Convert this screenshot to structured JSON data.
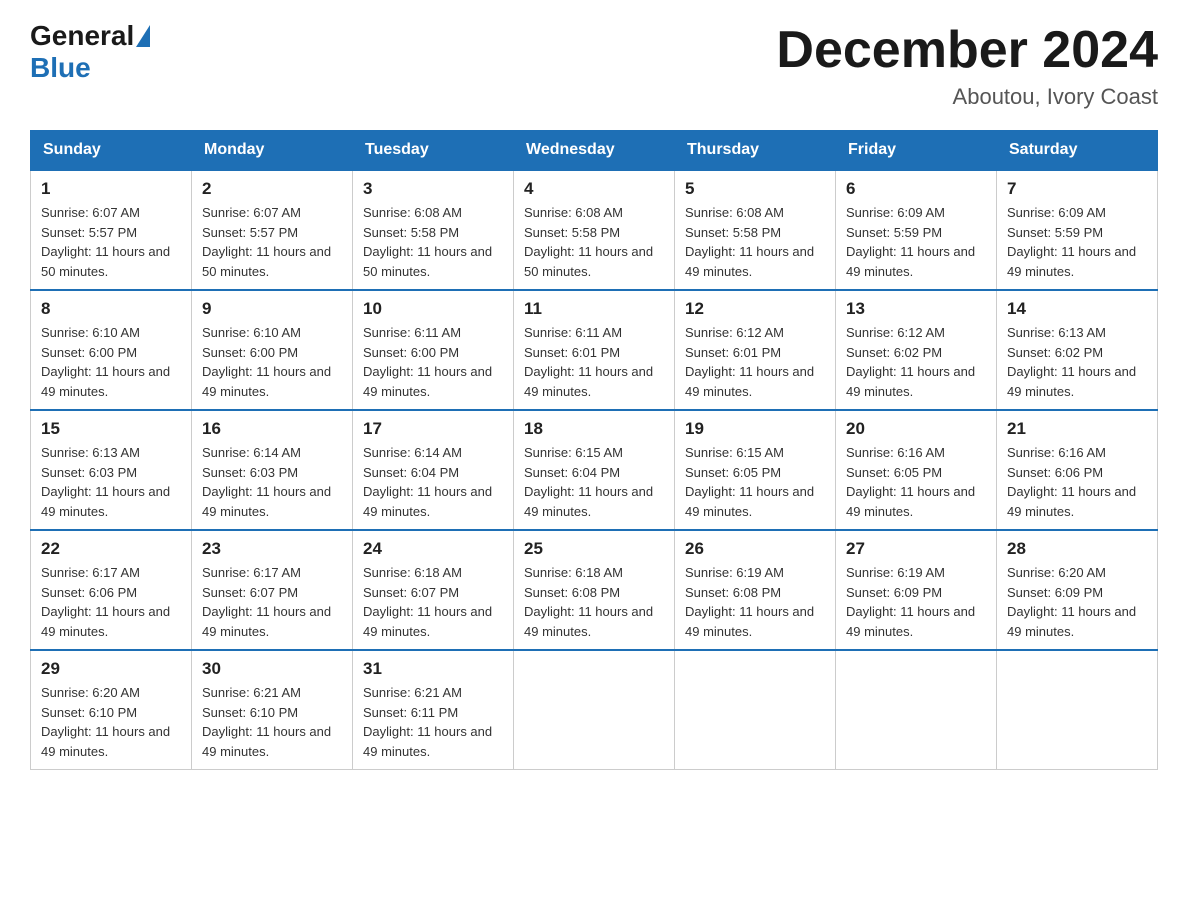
{
  "logo": {
    "general": "General",
    "blue": "Blue"
  },
  "title": {
    "month": "December 2024",
    "location": "Aboutou, Ivory Coast"
  },
  "days_of_week": [
    "Sunday",
    "Monday",
    "Tuesday",
    "Wednesday",
    "Thursday",
    "Friday",
    "Saturday"
  ],
  "weeks": [
    [
      {
        "day": "1",
        "sunrise": "6:07 AM",
        "sunset": "5:57 PM",
        "daylight": "11 hours and 50 minutes."
      },
      {
        "day": "2",
        "sunrise": "6:07 AM",
        "sunset": "5:57 PM",
        "daylight": "11 hours and 50 minutes."
      },
      {
        "day": "3",
        "sunrise": "6:08 AM",
        "sunset": "5:58 PM",
        "daylight": "11 hours and 50 minutes."
      },
      {
        "day": "4",
        "sunrise": "6:08 AM",
        "sunset": "5:58 PM",
        "daylight": "11 hours and 50 minutes."
      },
      {
        "day": "5",
        "sunrise": "6:08 AM",
        "sunset": "5:58 PM",
        "daylight": "11 hours and 49 minutes."
      },
      {
        "day": "6",
        "sunrise": "6:09 AM",
        "sunset": "5:59 PM",
        "daylight": "11 hours and 49 minutes."
      },
      {
        "day": "7",
        "sunrise": "6:09 AM",
        "sunset": "5:59 PM",
        "daylight": "11 hours and 49 minutes."
      }
    ],
    [
      {
        "day": "8",
        "sunrise": "6:10 AM",
        "sunset": "6:00 PM",
        "daylight": "11 hours and 49 minutes."
      },
      {
        "day": "9",
        "sunrise": "6:10 AM",
        "sunset": "6:00 PM",
        "daylight": "11 hours and 49 minutes."
      },
      {
        "day": "10",
        "sunrise": "6:11 AM",
        "sunset": "6:00 PM",
        "daylight": "11 hours and 49 minutes."
      },
      {
        "day": "11",
        "sunrise": "6:11 AM",
        "sunset": "6:01 PM",
        "daylight": "11 hours and 49 minutes."
      },
      {
        "day": "12",
        "sunrise": "6:12 AM",
        "sunset": "6:01 PM",
        "daylight": "11 hours and 49 minutes."
      },
      {
        "day": "13",
        "sunrise": "6:12 AM",
        "sunset": "6:02 PM",
        "daylight": "11 hours and 49 minutes."
      },
      {
        "day": "14",
        "sunrise": "6:13 AM",
        "sunset": "6:02 PM",
        "daylight": "11 hours and 49 minutes."
      }
    ],
    [
      {
        "day": "15",
        "sunrise": "6:13 AM",
        "sunset": "6:03 PM",
        "daylight": "11 hours and 49 minutes."
      },
      {
        "day": "16",
        "sunrise": "6:14 AM",
        "sunset": "6:03 PM",
        "daylight": "11 hours and 49 minutes."
      },
      {
        "day": "17",
        "sunrise": "6:14 AM",
        "sunset": "6:04 PM",
        "daylight": "11 hours and 49 minutes."
      },
      {
        "day": "18",
        "sunrise": "6:15 AM",
        "sunset": "6:04 PM",
        "daylight": "11 hours and 49 minutes."
      },
      {
        "day": "19",
        "sunrise": "6:15 AM",
        "sunset": "6:05 PM",
        "daylight": "11 hours and 49 minutes."
      },
      {
        "day": "20",
        "sunrise": "6:16 AM",
        "sunset": "6:05 PM",
        "daylight": "11 hours and 49 minutes."
      },
      {
        "day": "21",
        "sunrise": "6:16 AM",
        "sunset": "6:06 PM",
        "daylight": "11 hours and 49 minutes."
      }
    ],
    [
      {
        "day": "22",
        "sunrise": "6:17 AM",
        "sunset": "6:06 PM",
        "daylight": "11 hours and 49 minutes."
      },
      {
        "day": "23",
        "sunrise": "6:17 AM",
        "sunset": "6:07 PM",
        "daylight": "11 hours and 49 minutes."
      },
      {
        "day": "24",
        "sunrise": "6:18 AM",
        "sunset": "6:07 PM",
        "daylight": "11 hours and 49 minutes."
      },
      {
        "day": "25",
        "sunrise": "6:18 AM",
        "sunset": "6:08 PM",
        "daylight": "11 hours and 49 minutes."
      },
      {
        "day": "26",
        "sunrise": "6:19 AM",
        "sunset": "6:08 PM",
        "daylight": "11 hours and 49 minutes."
      },
      {
        "day": "27",
        "sunrise": "6:19 AM",
        "sunset": "6:09 PM",
        "daylight": "11 hours and 49 minutes."
      },
      {
        "day": "28",
        "sunrise": "6:20 AM",
        "sunset": "6:09 PM",
        "daylight": "11 hours and 49 minutes."
      }
    ],
    [
      {
        "day": "29",
        "sunrise": "6:20 AM",
        "sunset": "6:10 PM",
        "daylight": "11 hours and 49 minutes."
      },
      {
        "day": "30",
        "sunrise": "6:21 AM",
        "sunset": "6:10 PM",
        "daylight": "11 hours and 49 minutes."
      },
      {
        "day": "31",
        "sunrise": "6:21 AM",
        "sunset": "6:11 PM",
        "daylight": "11 hours and 49 minutes."
      },
      null,
      null,
      null,
      null
    ]
  ]
}
